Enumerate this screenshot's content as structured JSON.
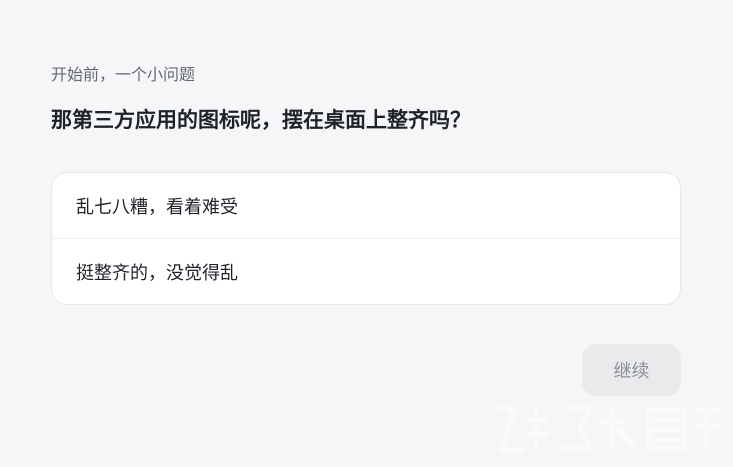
{
  "kicker": "开始前，一个小问题",
  "question": "那第三方应用的图标呢，摆在桌面上整齐吗？",
  "options": [
    {
      "label": "乱七八糟，看着难受"
    },
    {
      "label": "挺整齐的，没觉得乱"
    }
  ],
  "continue_label": "继续",
  "colors": {
    "background": "#f5f6f8",
    "card": "#ffffff",
    "button_bg": "#e9eaec",
    "button_text": "#8b8f96"
  }
}
